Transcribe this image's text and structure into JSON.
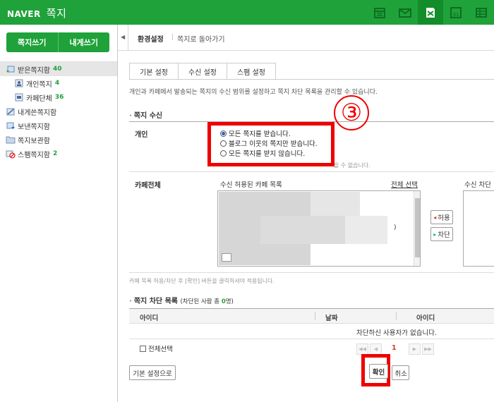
{
  "app": {
    "brand": "NAVER",
    "title": "쪽지"
  },
  "top_icons": [
    "calendar-list-icon",
    "mail-icon",
    "note-icon",
    "calendar-31-icon",
    "menu-table-icon"
  ],
  "sidebar": {
    "write_button": "쪽지쓰기",
    "self_write_button": "내게쓰기",
    "items": [
      {
        "label": "받은쪽지함",
        "count": "40",
        "icon": "inbox-icon"
      },
      {
        "label": "개인쪽지",
        "count": "4",
        "icon": "person-icon"
      },
      {
        "label": "카페단체",
        "count": "36",
        "icon": "cafe-icon"
      },
      {
        "label": "내게쓴쪽지함",
        "count": "",
        "icon": "self-note-icon"
      },
      {
        "label": "보낸쪽지함",
        "count": "",
        "icon": "sent-icon"
      },
      {
        "label": "쪽지보관함",
        "count": "",
        "icon": "folder-icon"
      },
      {
        "label": "스팸쪽지함",
        "count": "2",
        "icon": "spam-icon"
      }
    ]
  },
  "breadcrumb": {
    "current": "환경설정",
    "back": "쪽지로 돌아가기"
  },
  "tabs": [
    "기본 설정",
    "수신 설정",
    "스팸 설정"
  ],
  "description": "개인과 카페에서 발송되는 쪽지의 수신 범위를 설정하고 쪽지 차단 목록을 관리할 수 있습니다.",
  "receive": {
    "title": "쪽지 수신",
    "personal_label": "개인",
    "options": [
      "모든 쪽지를 받습니다.",
      "블로그 이웃의 쪽지만 받습니다.",
      "모든 쪽지를 받지 않습니다."
    ],
    "selected_option": 0,
    "hint": "을 수 없습니다.",
    "annotation": "③",
    "cafe_label": "카페전체",
    "cafe_allowed_title": "수신 허용된 카페 목록",
    "select_all_link": "전체 선택",
    "cafe_blocked_title": "수신 차단",
    "paren": ")",
    "allow_button": "허용",
    "block_button": "차단",
    "cafe_note": "카페 목록 허용/차단 후 [확인] 버튼을 클릭하셔야 적용됩니다."
  },
  "block_list": {
    "title": "쪽지 차단 목록",
    "sub_prefix": "(차단된 사람 총 ",
    "count": "0",
    "sub_suffix": "명)",
    "columns": [
      "아이디",
      "날짜",
      "아이디"
    ],
    "empty": "차단하신 사용자가 없습니다.",
    "select_all": "전체선택",
    "page": "1"
  },
  "footer": {
    "reset": "기본 설정으로",
    "confirm": "확인",
    "cancel": "취소"
  },
  "colors": {
    "brand": "#1fa23a",
    "highlight": "#ee0000"
  }
}
